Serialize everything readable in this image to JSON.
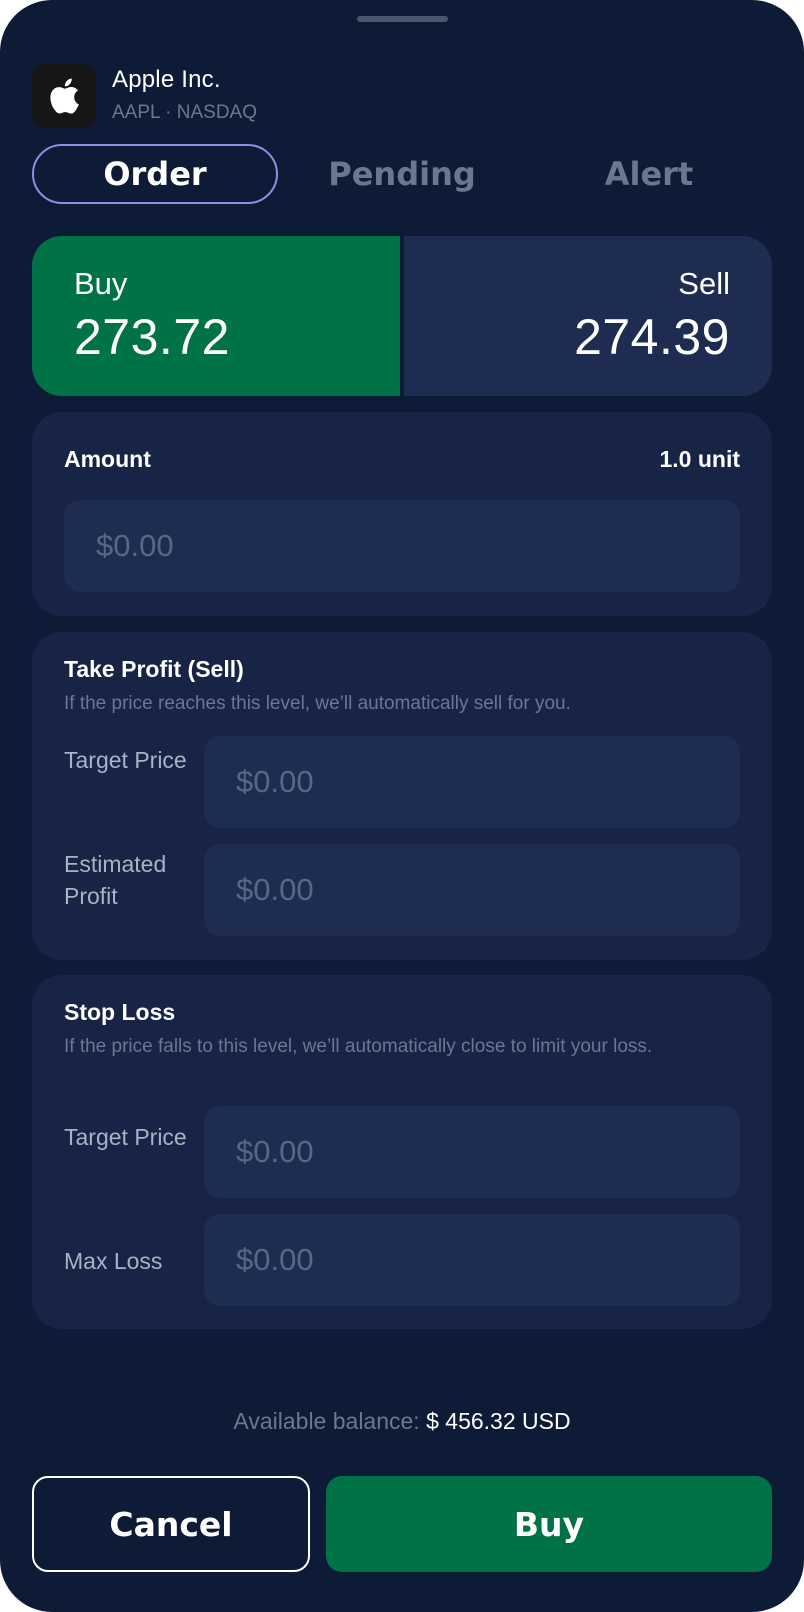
{
  "header": {
    "company_name": "Apple Inc.",
    "meta": "AAPL · NASDAQ",
    "logo_icon": "apple-logo"
  },
  "tabs": [
    {
      "label": "Order",
      "active": true
    },
    {
      "label": "Pending",
      "active": false
    },
    {
      "label": "Alert",
      "active": false
    }
  ],
  "trade": {
    "buy_label": "Buy",
    "buy_price": "273.72",
    "sell_label": "Sell",
    "sell_price": "274.39"
  },
  "amount": {
    "title": "Amount",
    "unit": "1.0 unit",
    "placeholder": "$0.00"
  },
  "take_profit": {
    "title": "Take Profit (Sell)",
    "description": "If the price reaches this level, we’ll automatically sell for you.",
    "fields": [
      {
        "label": "Target Price",
        "placeholder": "$0.00"
      },
      {
        "label": "Estimated Profit",
        "placeholder": "$0.00"
      }
    ]
  },
  "stop_loss": {
    "title": "Stop Loss",
    "description": "If the price falls to this level, we’ll automatically close to limit your loss.",
    "fields": [
      {
        "label": "Target Price",
        "placeholder": "$0.00"
      },
      {
        "label": "Max Loss",
        "placeholder": "$0.00"
      }
    ]
  },
  "balance": {
    "label": "Available balance:",
    "value": "$ 456.32",
    "currency": "USD"
  },
  "actions": {
    "cancel_label": "Cancel",
    "buy_label": "Buy"
  },
  "colors": {
    "background": "#0d1b36",
    "card": "#172446",
    "field": "#1e2c52",
    "buy_green": "#007346",
    "tab_active_border": "#8a8fe0"
  }
}
